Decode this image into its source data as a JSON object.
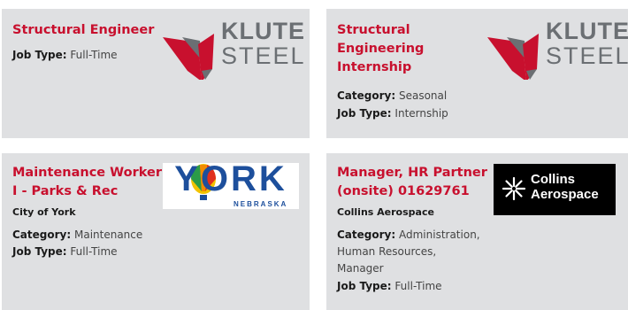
{
  "colors": {
    "card_bg": "#dfe0e2",
    "title": "#c8102e",
    "klute_red": "#c8102e",
    "klute_gray": "#6b6f73",
    "york_blue": "#1d4f9c",
    "collins_bg": "#000000"
  },
  "labels": {
    "category": "Category:",
    "job_type": "Job Type:"
  },
  "jobs": [
    {
      "title": "Structural Engineer",
      "job_type": "Full-Time",
      "logo_text_1": "KLUTE",
      "logo_text_2": "STEEL"
    },
    {
      "title_lines": [
        "Structural",
        "Engineering",
        "Internship"
      ],
      "category": "Seasonal",
      "job_type": "Internship",
      "logo_text_1": "KLUTE",
      "logo_text_2": "STEEL"
    },
    {
      "title_lines": [
        "Maintenance Worker",
        "I - Parks & Rec"
      ],
      "employer": "City of York",
      "category": "Maintenance",
      "job_type": "Full-Time",
      "logo_text_1": "YORK",
      "logo_text_2": "NEBRASKA"
    },
    {
      "title_lines": [
        "Manager, HR Partner",
        "(onsite) 01629761"
      ],
      "employer": "Collins Aerospace",
      "category_lines": [
        "Administration,",
        "Human Resources,",
        "Manager"
      ],
      "job_type": "Full-Time",
      "logo_text_1": "Collins",
      "logo_text_2": "Aerospace"
    }
  ]
}
